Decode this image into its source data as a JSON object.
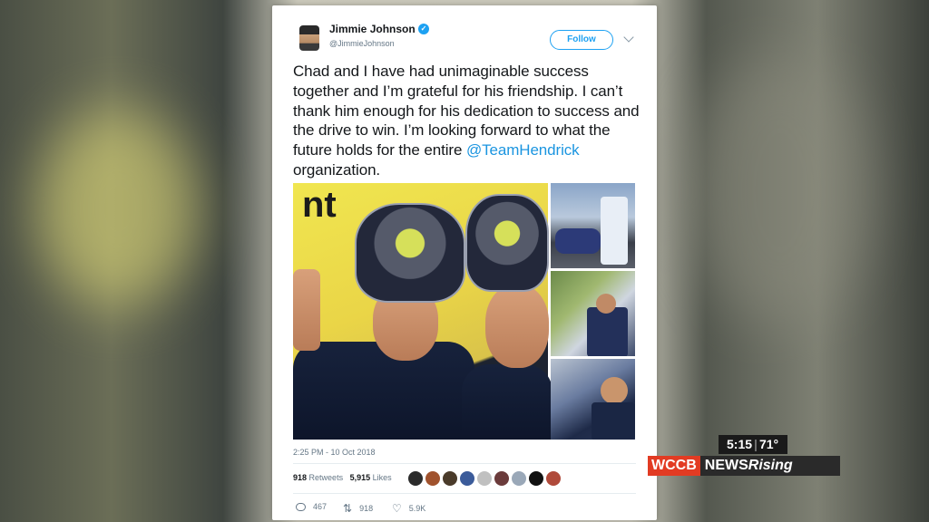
{
  "tweet": {
    "author_name": "Jimmie Johnson",
    "author_handle": "@JimmieJohnson",
    "verified_glyph": "✓",
    "follow_label": "Follow",
    "text_before": "Chad and I have had unimaginable success together and I’m grateful for his friendship. I can’t thank him enough for his dedication to success and the drive to win. I’m looking forward to what the future holds for the entire ",
    "mention": "@TeamHendrick",
    "text_after": " organization.",
    "media_sponsor_text": "nt",
    "timestamp": "2:25 PM - 10 Oct 2018",
    "retweets_count": "918",
    "retweets_label": "Retweets",
    "likes_count": "5,915",
    "likes_label": "Likes",
    "actions": {
      "reply_count": "467",
      "retweet_count": "918",
      "like_count": "5.9K"
    },
    "liker_avatar_colors": [
      "#2b2b2b",
      "#a0522d",
      "#4a3b2a",
      "#3b5b9a",
      "#c0c0c0",
      "#6b3b3b",
      "#9aa8b8",
      "#111111",
      "#b04a3a"
    ]
  },
  "broadcast": {
    "time": "5:15",
    "temperature": "71°",
    "station": "WCCB",
    "news": "NEWS",
    "rising": "Rising",
    "station_color": "#e23b23"
  },
  "icons": [
    "verified-icon",
    "chevron-down-icon",
    "reply-icon",
    "retweet-icon",
    "like-icon"
  ]
}
